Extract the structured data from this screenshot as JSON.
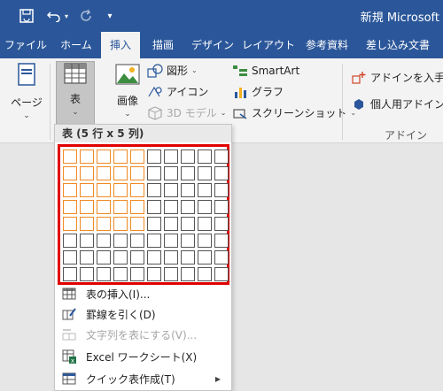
{
  "title_bar": {
    "title": "新規 Microsoft",
    "icons": [
      "save-icon",
      "undo-icon",
      "redo-icon",
      "customize-toolbar-icon"
    ]
  },
  "tabs": [
    {
      "label": "ファイル"
    },
    {
      "label": "ホーム"
    },
    {
      "label": "挿入",
      "active": true
    },
    {
      "label": "描画"
    },
    {
      "label": "デザイン"
    },
    {
      "label": "レイアウト"
    },
    {
      "label": "参考資料"
    },
    {
      "label": "差し込み文書"
    }
  ],
  "ribbon": {
    "pages_label": "ページ",
    "table_label": "表",
    "image_label": "画像",
    "shapes_label": "図形",
    "icons_label": "アイコン",
    "model3d_label": "3D モデル",
    "smartart_label": "SmartArt",
    "chart_label": "グラフ",
    "screenshot_label": "スクリーンショット",
    "get_addins_label": "アドインを入手",
    "my_addins_label": "個人用アドイン",
    "addins_group_label": "アドイン"
  },
  "table_dropdown": {
    "title": "表 (5 行 x 5 列)",
    "selected_rows": 5,
    "selected_cols": 5,
    "grid_rows": 8,
    "grid_cols": 10,
    "selection_color": "#f08a24",
    "highlight_color": "#e00000",
    "menu": [
      {
        "label": "表の挿入(I)...",
        "icon": "insert-table-icon",
        "disabled": false
      },
      {
        "label": "罫線を引く(D)",
        "icon": "draw-table-icon",
        "disabled": false
      },
      {
        "label": "文字列を表にする(V)...",
        "icon": "convert-text-to-table-icon",
        "disabled": true
      },
      {
        "label": "Excel ワークシート(X)",
        "icon": "excel-spreadsheet-icon",
        "disabled": false
      },
      {
        "label": "クイック表作成(T)",
        "icon": "quick-tables-icon",
        "disabled": false,
        "submenu": true
      }
    ]
  },
  "colors": {
    "title_bar": "#2b579a",
    "ribbon_bg": "#f3f3f3",
    "doc_bg": "#e6e6e6"
  }
}
